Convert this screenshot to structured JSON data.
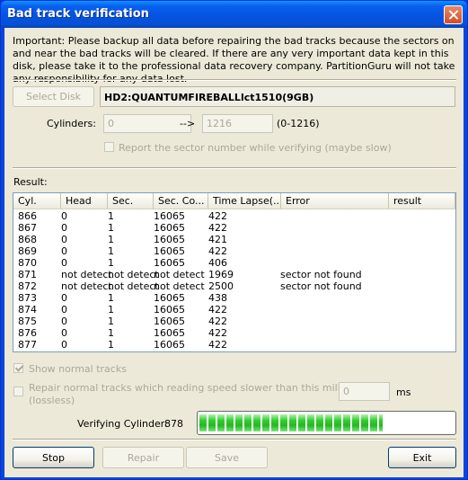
{
  "window": {
    "title": "Bad track verification"
  },
  "notice": "Important: Please backup all data before repairing the bad tracks because the sectors on and near the bad tracks will be cleared. If there are any very important data kept in this disk, please take it to the professional data recovery company. PartitionGuru will not take any responsibility for any data lost.",
  "disk": {
    "select_label": "Select Disk",
    "name": "HD2:QUANTUMFIREBALLlct1510(9GB)"
  },
  "cylinders": {
    "label": "Cylinders:",
    "from": "0",
    "arrow": "-->",
    "to": "1216",
    "range": "(0-1216)"
  },
  "report_sector": {
    "label": "Report the sector number while verifying (maybe slow)",
    "checked": false
  },
  "result_label": "Result:",
  "table": {
    "columns": [
      "Cyl.",
      "Head",
      "Sec.",
      "Sec. Co...",
      "Time Lapse(...",
      "Error",
      "result"
    ],
    "rows": [
      [
        "866",
        "0",
        "1",
        "16065",
        "422",
        "",
        ""
      ],
      [
        "867",
        "0",
        "1",
        "16065",
        "422",
        "",
        ""
      ],
      [
        "868",
        "0",
        "1",
        "16065",
        "421",
        "",
        ""
      ],
      [
        "869",
        "0",
        "1",
        "16065",
        "422",
        "",
        ""
      ],
      [
        "870",
        "0",
        "1",
        "16065",
        "406",
        "",
        ""
      ],
      [
        "871",
        "not detect",
        "not detect",
        "not detect",
        "1969",
        "sector not found",
        ""
      ],
      [
        "872",
        "not detect",
        "not detect",
        "not detect",
        "2500",
        "sector not found",
        ""
      ],
      [
        "873",
        "0",
        "1",
        "16065",
        "438",
        "",
        ""
      ],
      [
        "874",
        "0",
        "1",
        "16065",
        "422",
        "",
        ""
      ],
      [
        "875",
        "0",
        "1",
        "16065",
        "422",
        "",
        ""
      ],
      [
        "876",
        "0",
        "1",
        "16065",
        "422",
        "",
        ""
      ],
      [
        "877",
        "0",
        "1",
        "16065",
        "422",
        "",
        ""
      ]
    ]
  },
  "show_normal": {
    "label": "Show normal tracks",
    "checked": true
  },
  "repair_normal": {
    "label_line1": "Repair normal tracks which reading speed slower than this millisecond:",
    "label_line2": "(lossless)",
    "value": "0",
    "unit": "ms",
    "checked": false
  },
  "progress": {
    "label": "Verifying Cylinder:",
    "cylinder": "878",
    "fraction": 0.72
  },
  "buttons": {
    "stop": "Stop",
    "repair": "Repair",
    "save": "Save",
    "exit": "Exit"
  },
  "colors": {
    "title_bar": "#0a58e6",
    "progress": "#2ec22c",
    "face": "#ece9d8"
  }
}
